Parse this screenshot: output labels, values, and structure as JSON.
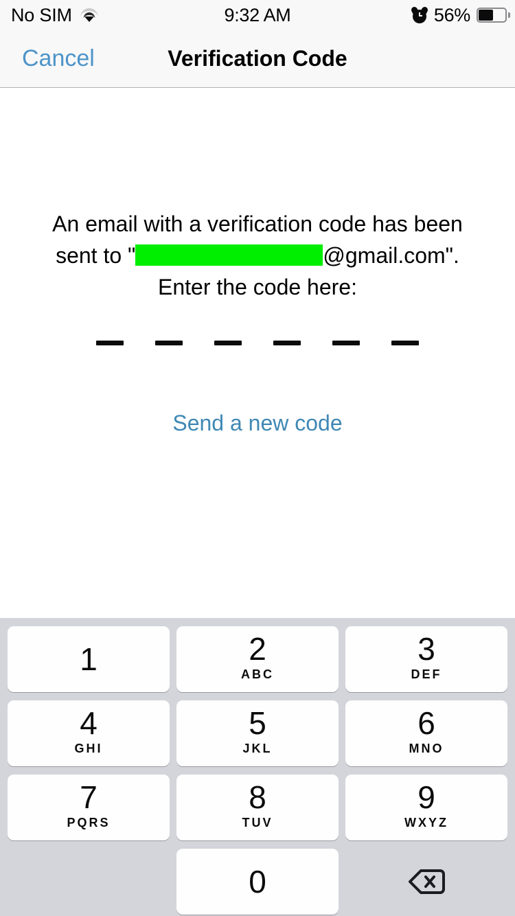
{
  "statusbar": {
    "carrier": "No SIM",
    "wifi_icon": "wifi-icon",
    "time": "9:32 AM",
    "alarm_icon": "alarm-clock-icon",
    "battery_percent": "56%",
    "battery_level": 56
  },
  "navbar": {
    "cancel_label": "Cancel",
    "title": "Verification Code"
  },
  "content": {
    "prompt_line1": "An email with a verification code has been",
    "prompt_before_redaction": "sent to \"",
    "redacted_email_placeholder": "",
    "prompt_after_redaction": "@gmail.com\".",
    "prompt_line3": "Enter the code here:",
    "redaction_color": "#00ee00",
    "code_length": 6,
    "code_value": "",
    "code_placeholder_char": "—",
    "send_new_code_label": "Send a new code",
    "link_color": "#3f88b4"
  },
  "keypad": {
    "rows": [
      [
        {
          "digit": "1",
          "letters": ""
        },
        {
          "digit": "2",
          "letters": "ABC"
        },
        {
          "digit": "3",
          "letters": "DEF"
        }
      ],
      [
        {
          "digit": "4",
          "letters": "GHI"
        },
        {
          "digit": "5",
          "letters": "JKL"
        },
        {
          "digit": "6",
          "letters": "MNO"
        }
      ],
      [
        {
          "digit": "7",
          "letters": "PQRS"
        },
        {
          "digit": "8",
          "letters": "TUV"
        },
        {
          "digit": "9",
          "letters": "WXYZ"
        }
      ]
    ],
    "zero_key": {
      "digit": "0",
      "letters": ""
    },
    "backspace_icon": "backspace-delete-icon",
    "background_color": "#d3d5db",
    "key_color": "#fefefe"
  }
}
